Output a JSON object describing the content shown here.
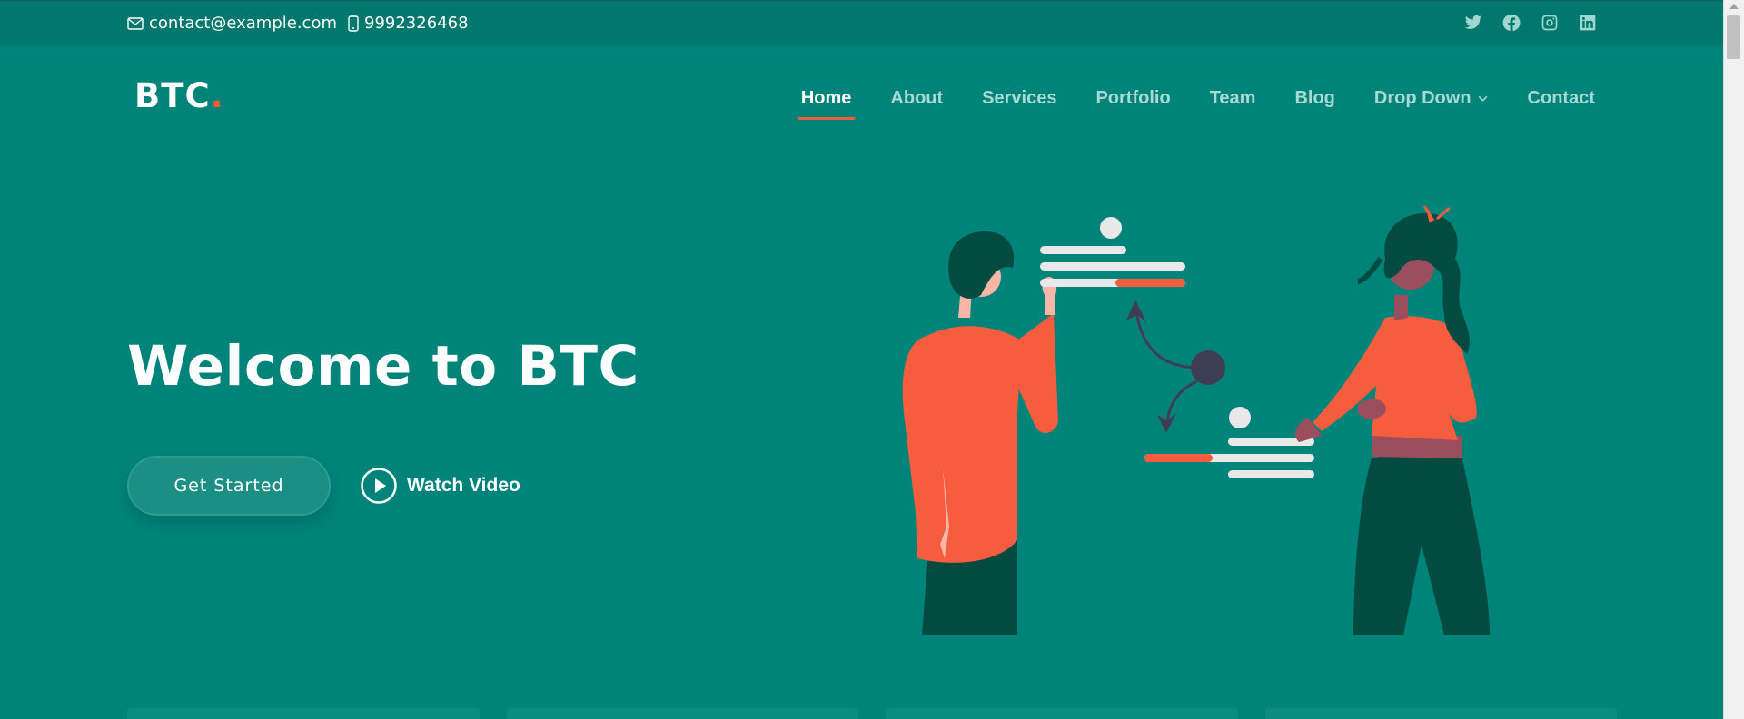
{
  "topbar": {
    "email": "contact@example.com",
    "phone": "9992326468",
    "socials": [
      "twitter-icon",
      "facebook-icon",
      "instagram-icon",
      "linkedin-icon"
    ]
  },
  "header": {
    "logo_text": "BTC",
    "logo_dot": ".",
    "nav": [
      {
        "label": "Home",
        "active": true
      },
      {
        "label": "About"
      },
      {
        "label": "Services"
      },
      {
        "label": "Portfolio"
      },
      {
        "label": "Team"
      },
      {
        "label": "Blog"
      },
      {
        "label": "Drop Down",
        "has_dropdown": true
      },
      {
        "label": "Contact"
      }
    ]
  },
  "hero": {
    "title": "Welcome to BTC",
    "cta_label": "Get Started",
    "video_label": "Watch Video"
  },
  "colors": {
    "background": "#00847a",
    "topbar": "#00786d",
    "accent": "#f25c3d",
    "nav_inactive": "#a6dad3"
  }
}
